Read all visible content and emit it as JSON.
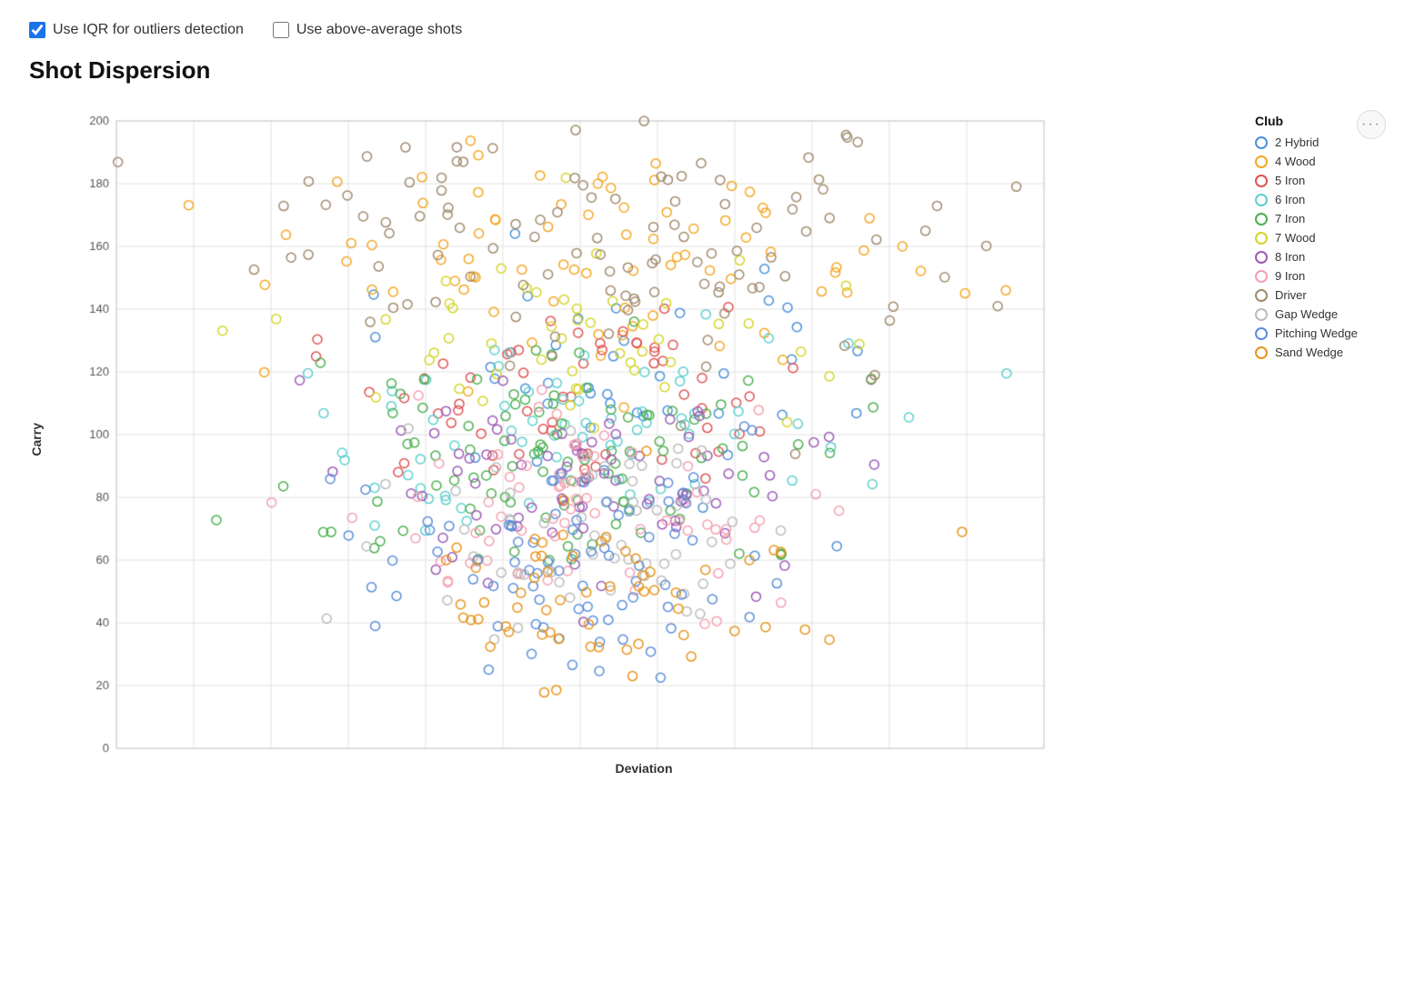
{
  "controls": {
    "iqr_label": "Use IQR for outliers detection",
    "iqr_checked": true,
    "above_avg_label": "Use above-average shots",
    "above_avg_checked": false
  },
  "chart": {
    "title": "Shot Dispersion",
    "x_axis_label": "Deviation",
    "y_axis_label": "Carry",
    "x_min": -60,
    "x_max": 60,
    "y_min": 0,
    "y_max": 200
  },
  "legend": {
    "title": "Club",
    "items": [
      {
        "label": "2 Hybrid",
        "color": "#4a90d9"
      },
      {
        "label": "4 Wood",
        "color": "#f5a623"
      },
      {
        "label": "5 Iron",
        "color": "#e05252"
      },
      {
        "label": "6 Iron",
        "color": "#5ecfcf"
      },
      {
        "label": "7 Iron",
        "color": "#4caf50"
      },
      {
        "label": "7 Wood",
        "color": "#d4d429"
      },
      {
        "label": "8 Iron",
        "color": "#9b59b6"
      },
      {
        "label": "9 Iron",
        "color": "#f4a0b0"
      },
      {
        "label": "Driver",
        "color": "#a0896c"
      },
      {
        "label": "Gap Wedge",
        "color": "#bbb"
      },
      {
        "label": "Pitching Wedge",
        "color": "#5b8dd9"
      },
      {
        "label": "Sand Wedge",
        "color": "#e8931a"
      }
    ]
  },
  "dots_button_label": "···"
}
